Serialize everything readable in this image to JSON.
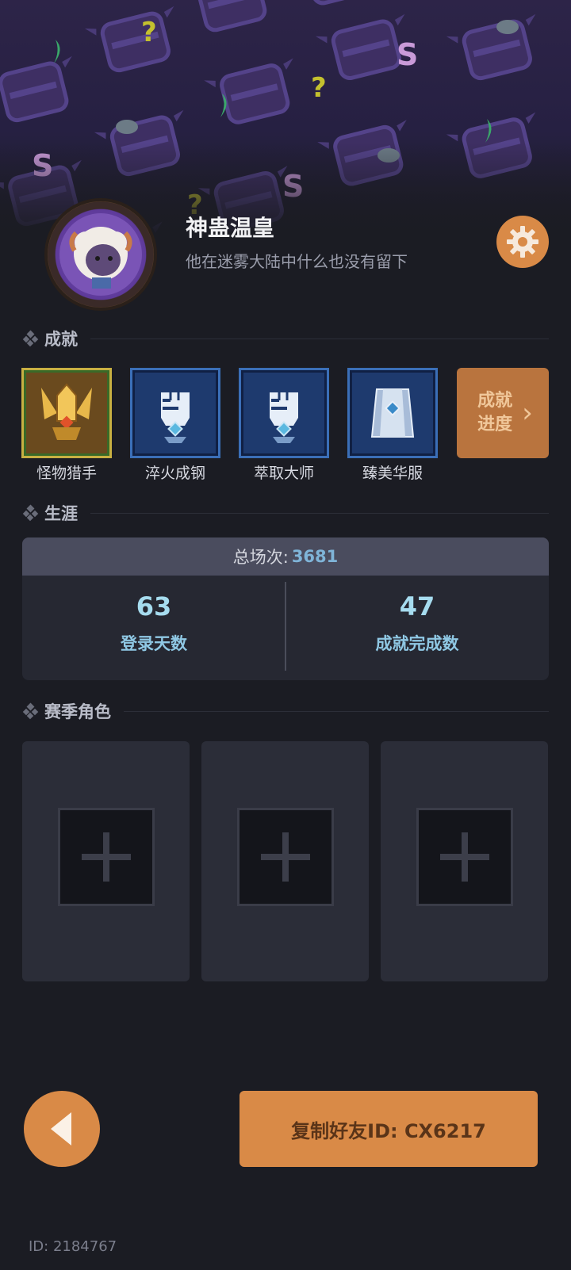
{
  "profile": {
    "name": "神蛊温皇",
    "motto": "他在迷雾大陆中什么也没有留下"
  },
  "sections": {
    "achievements": "成就",
    "career": "生涯",
    "season_roles": "赛季角色"
  },
  "achievements": [
    {
      "label": "怪物猎手",
      "icon": "golden-sword-icon",
      "style": "gold"
    },
    {
      "label": "淬火成钢",
      "icon": "fist-icon",
      "style": "blue"
    },
    {
      "label": "萃取大师",
      "icon": "fist-icon",
      "style": "blue"
    },
    {
      "label": "臻美华服",
      "icon": "cloak-icon",
      "style": "blue"
    }
  ],
  "achievement_progress": {
    "line1": "成就",
    "line2": "进度"
  },
  "career": {
    "total_label": "总场次:",
    "total_value": "3681",
    "stats": [
      {
        "value": "63",
        "label": "登录天数"
      },
      {
        "value": "47",
        "label": "成就完成数"
      }
    ]
  },
  "season_slots": [
    "empty",
    "empty",
    "empty"
  ],
  "bottom": {
    "copy_button": "复制好友ID: CX6217",
    "user_id": "ID: 2184767"
  },
  "colors": {
    "accent": "#d98a47",
    "background": "#1b1c23",
    "stat_value": "#a6dcef"
  }
}
